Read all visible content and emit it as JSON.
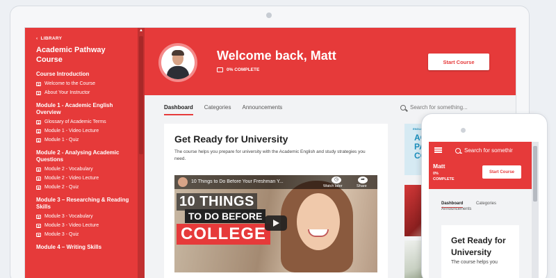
{
  "sidebar": {
    "back_label": "LIBRARY",
    "course_title": "Academic Pathway Course",
    "sections": [
      {
        "title": "Course Introduction",
        "lessons": [
          "Welcome to the Course",
          "About Your Instructor"
        ]
      },
      {
        "title": "Module 1 - Academic English Overview",
        "lessons": [
          "Glossary of Academic Terms",
          "Module 1 - Video Lecture",
          "Module 1 - Quiz"
        ]
      },
      {
        "title": "Module 2 - Analysing Academic Questions",
        "lessons": [
          "Module 2 - Vocabulary",
          "Module 2 - Video Lecture",
          "Module 2 - Quiz"
        ]
      },
      {
        "title": "Module 3 – Researching & Reading Skills",
        "lessons": [
          "Module 3 - Vocabulary",
          "Module 3 - Video Lecture",
          "Module 3 - Quiz"
        ]
      },
      {
        "title": "Module 4 – Writing Skills",
        "lessons": []
      }
    ]
  },
  "hero": {
    "welcome": "Welcome back, Matt",
    "progress_text": "0% COMPLETE",
    "start_button": "Start Course"
  },
  "tabs": {
    "dashboard": "Dashboard",
    "categories": "Categories",
    "announcements": "Announcements"
  },
  "search": {
    "placeholder": "Search for something..."
  },
  "card": {
    "title": "Get Ready for University",
    "description": "The course helps you prepare for university with the Academic English and study strategies you need."
  },
  "video": {
    "title": "10 Things to Do Before Your Freshman Y...",
    "watch_later": "Watch later",
    "share": "Share",
    "overlay_line1": "10 THINGS",
    "overlay_line2": "TO DO BEFORE",
    "overlay_line3": "COLLEGE"
  },
  "side_thumb": {
    "small": "ENGLISHSTUDYHUB",
    "line1": "ACAD",
    "line2": "PATH",
    "line3": "COUR"
  },
  "mobile": {
    "search": "Search for somethir",
    "name": "Matt",
    "progress_text": "0% COMPLETE",
    "start_button": "Start Course",
    "tab_dashboard": "Dashboard",
    "tab_categories": "Categories",
    "tab_announcements": "Announcements",
    "card_title": "Get Ready for University",
    "card_text": "The course helps you"
  },
  "colors": {
    "accent": "#e63a3a",
    "page_bg": "#f2f3f5"
  }
}
